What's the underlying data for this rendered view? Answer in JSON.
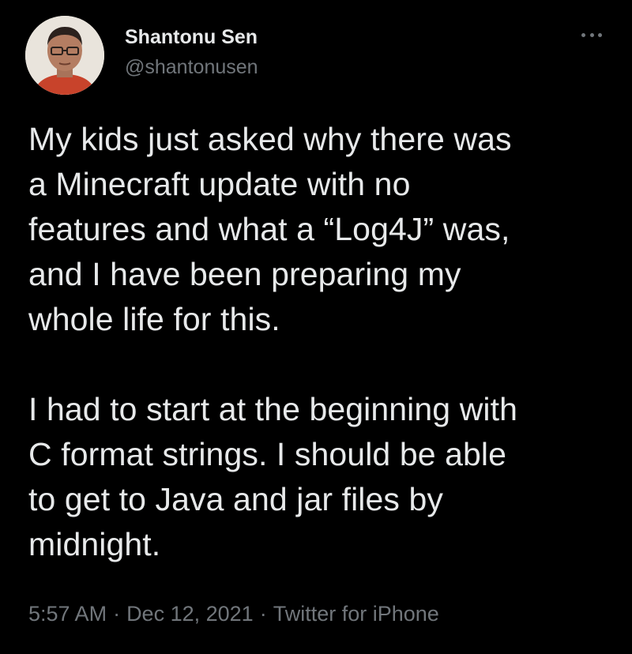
{
  "author": {
    "display_name": "Shantonu Sen",
    "handle": "@shantonusen",
    "avatar_icon": "user-avatar-photo"
  },
  "menu": {
    "icon": "more-horizontal-icon"
  },
  "tweet": {
    "paragraphs": [
      "My kids just asked why there was\na Minecraft update with no\nfeatures and what a “Log4J” was,\nand I have been preparing my\nwhole life for this.",
      "I had to start at the beginning with\nC format strings. I should be able\nto get to Java and jar files by\nmidnight."
    ]
  },
  "meta": {
    "time": "5:57 AM",
    "separator": "·",
    "date": "Dec 12, 2021",
    "source": "Twitter for iPhone"
  },
  "colors": {
    "background": "#000000",
    "primary_text": "#e7e9ea",
    "secondary_text": "#71767b"
  }
}
